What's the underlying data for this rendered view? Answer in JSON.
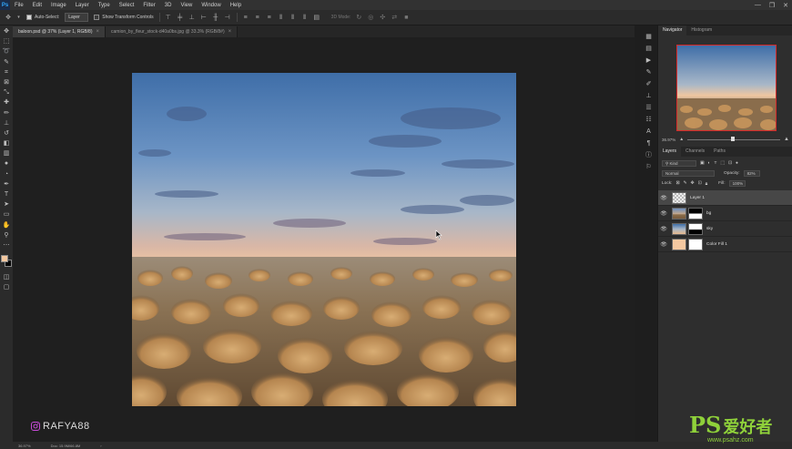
{
  "app": {
    "logo": "Ps"
  },
  "menu": [
    "File",
    "Edit",
    "Image",
    "Layer",
    "Type",
    "Select",
    "Filter",
    "3D",
    "View",
    "Window",
    "Help"
  ],
  "window_controls": {
    "minimize": "—",
    "restore": "❐",
    "close": "✕"
  },
  "options": {
    "auto_select_label": "Auto-Select:",
    "auto_select_target": "Layer",
    "show_transform_label": "Show Transform Controls",
    "mode_3d_label": "3D Mode:"
  },
  "tabs": [
    {
      "label": "baloon.psd @ 37% (Layer 1, RGB/8)",
      "active": true
    },
    {
      "label": "camion_by_fleur_stock-d40a0bs.jpg @ 33.3% (RGB/8#)",
      "active": false
    }
  ],
  "tab_close": "×",
  "watermark": "RAFYA88",
  "status": {
    "zoom": "36.97%",
    "doc": "Doc: 15.9M/66.8M",
    "arrow": "›"
  },
  "navigator": {
    "tabs": [
      "Navigator",
      "Histogram"
    ],
    "zoom_value": "36.97%",
    "zoom_fraction": 0.47
  },
  "layers_panel": {
    "tabs": [
      "Layers",
      "Channels",
      "Paths"
    ],
    "filter_label": "Kind",
    "blend_mode": "Normal",
    "opacity_label": "Opacity:",
    "opacity_value": "82%",
    "lock_label": "Lock:",
    "fill_label": "Fill:",
    "fill_value": "100%",
    "layers": [
      {
        "name": "Layer 1",
        "selected": true,
        "has_mask": false
      },
      {
        "name": "bg",
        "selected": false,
        "has_mask": true
      },
      {
        "name": "sky",
        "selected": false,
        "has_mask": true
      },
      {
        "name": "Color Fill 1",
        "selected": false,
        "has_mask": true
      }
    ]
  },
  "brand_watermark": {
    "ps": "PS",
    "cn": "爱好者",
    "url": "www.psahz.com"
  },
  "colors": {
    "foreground": "#f4c8a0",
    "background": "#000000",
    "selection_border": "#d62a2a",
    "brand_green": "#8fd13a"
  }
}
